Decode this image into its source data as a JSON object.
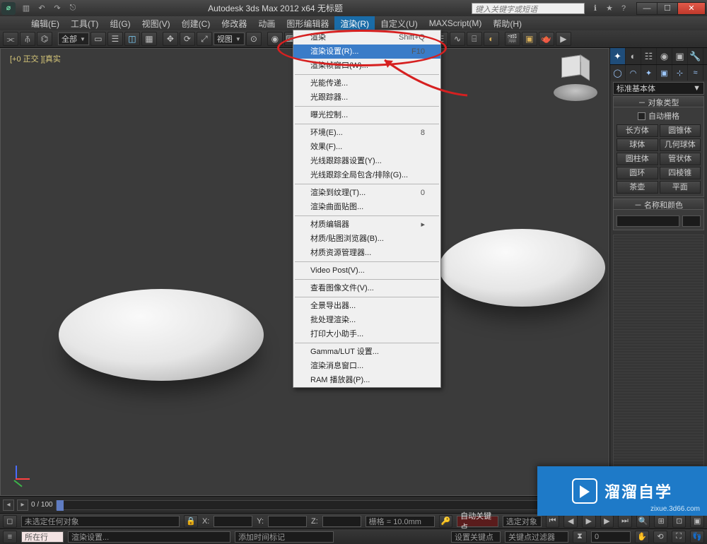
{
  "title": "Autodesk 3ds Max  2012 x64    无标题",
  "search_placeholder": "键入关键字或短语",
  "menus": [
    "编辑(E)",
    "工具(T)",
    "组(G)",
    "视图(V)",
    "创建(C)",
    "修改器",
    "动画",
    "图形编辑器",
    "渲染(R)",
    "自定义(U)",
    "MAXScript(M)",
    "帮助(H)"
  ],
  "active_menu_index": 8,
  "toolbar_selects": {
    "sel1": "全部",
    "sel2": "视图"
  },
  "viewport_label": "[+0 正交 ][真实",
  "dropdown": [
    {
      "t": "渲染",
      "s": "Shift+Q",
      "hover": false
    },
    {
      "t": "渲染设置(R)...",
      "s": "F10",
      "hover": true
    },
    {
      "t": "渲染帧窗口(W)...",
      "s": "",
      "hover": false
    },
    "sep",
    {
      "t": "光能传递...",
      "s": ""
    },
    {
      "t": "光跟踪器...",
      "s": ""
    },
    "sep",
    {
      "t": "曝光控制...",
      "s": ""
    },
    "sep",
    {
      "t": "环境(E)...",
      "s": "8"
    },
    {
      "t": "效果(F)...",
      "s": ""
    },
    {
      "t": "光线跟踪器设置(Y)...",
      "s": ""
    },
    {
      "t": "光线跟踪全局包含/排除(G)...",
      "s": ""
    },
    "sep",
    {
      "t": "渲染到纹理(T)...",
      "s": "0"
    },
    {
      "t": "渲染曲面贴图...",
      "s": ""
    },
    "sep",
    {
      "t": "材质编辑器",
      "s": "▸"
    },
    {
      "t": "材质/贴图浏览器(B)...",
      "s": ""
    },
    {
      "t": "材质资源管理器...",
      "s": ""
    },
    "sep",
    {
      "t": "Video Post(V)...",
      "s": ""
    },
    "sep",
    {
      "t": "查看图像文件(V)...",
      "s": ""
    },
    "sep",
    {
      "t": "全景导出器...",
      "s": ""
    },
    {
      "t": "批处理渲染...",
      "s": ""
    },
    {
      "t": "打印大小助手...",
      "s": ""
    },
    "sep",
    {
      "t": "Gamma/LUT 设置...",
      "s": ""
    },
    {
      "t": "渲染消息窗口...",
      "s": ""
    },
    {
      "t": "RAM 播放器(P)...",
      "s": ""
    }
  ],
  "cmd_sel": "标准基本体",
  "rollout_types_title": "对象类型",
  "autogrid": "自动栅格",
  "primitives": [
    [
      "长方体",
      "圆锥体"
    ],
    [
      "球体",
      "几何球体"
    ],
    [
      "圆柱体",
      "管状体"
    ],
    [
      "圆环",
      "四棱锥"
    ],
    [
      "茶壶",
      "平面"
    ]
  ],
  "rollout_name_title": "名称和颜色",
  "timeline_frame": "0 / 100",
  "status": {
    "sel": "未选定任何对象",
    "render": "渲染设置...",
    "coord_x": "X:",
    "coord_y": "Y:",
    "coord_z": "Z:",
    "grid": "栅格 = 10.0mm",
    "autokey": "自动关键点",
    "selkey": "选定对象",
    "setkey": "设置关键点",
    "keyfilter": "关键点过滤器",
    "row2a": "所在行",
    "addtime": "添加时间标记"
  },
  "watermark": {
    "brand": "溜溜自学",
    "url": "zixue.3d66.com"
  }
}
